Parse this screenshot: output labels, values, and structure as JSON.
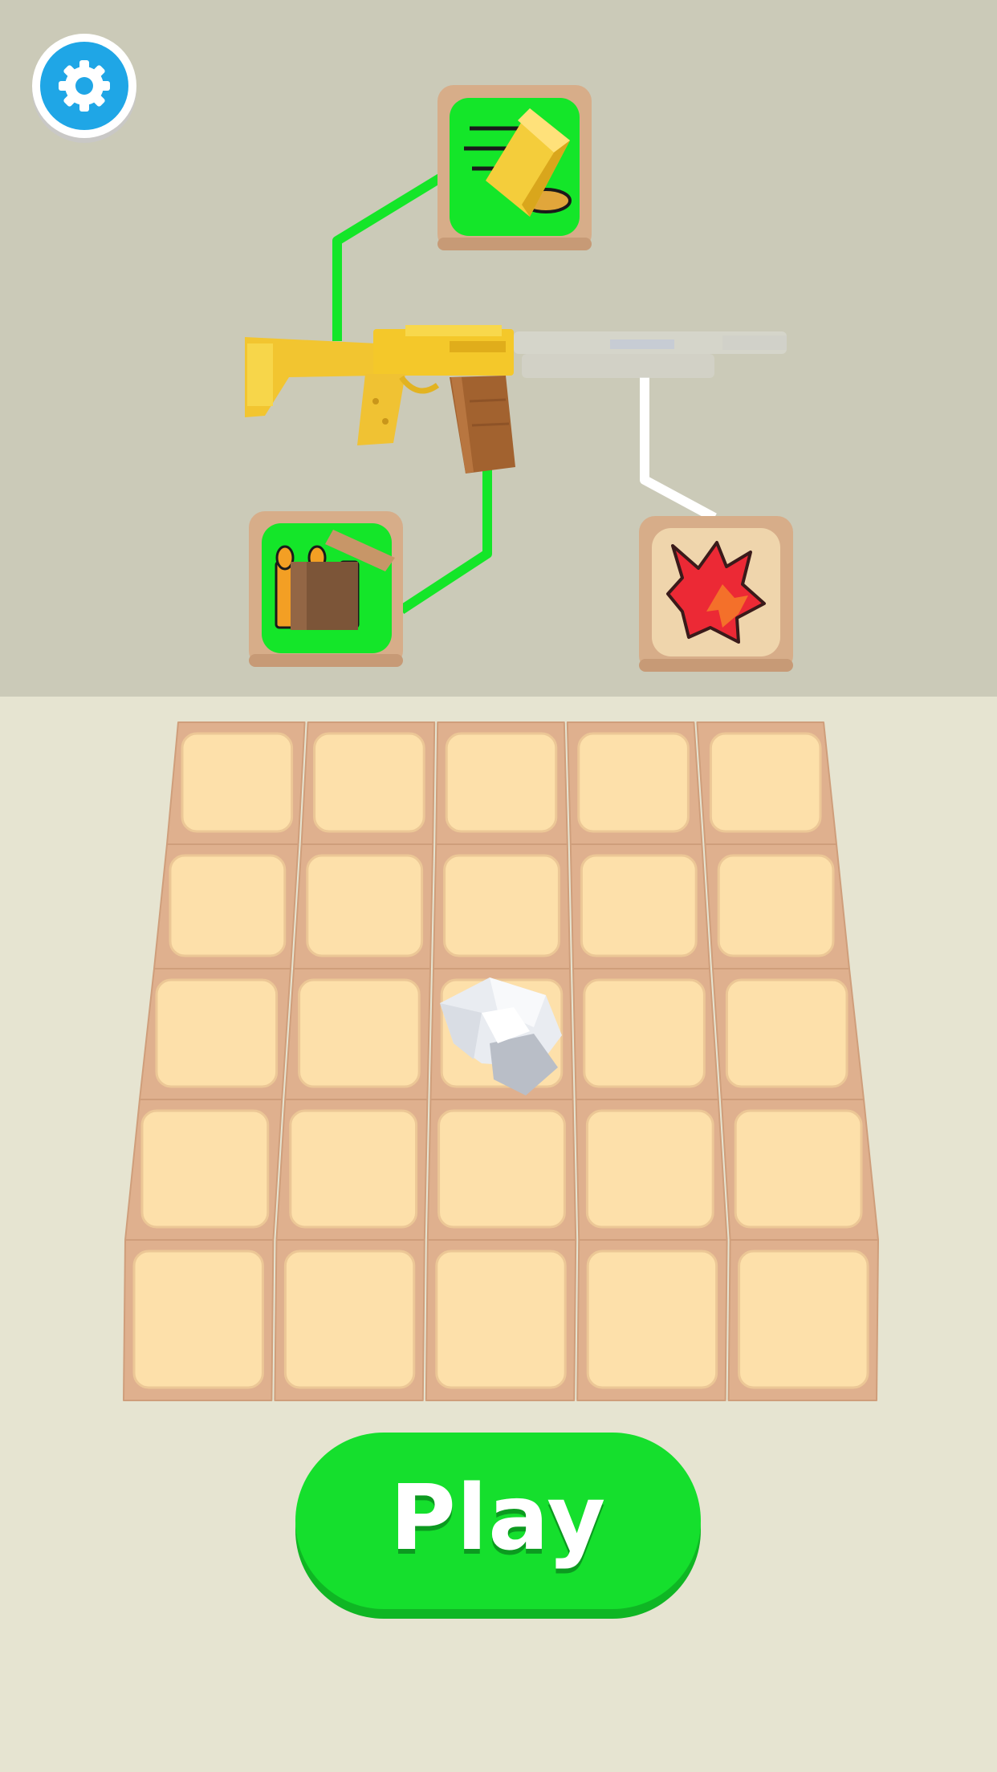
{
  "settings": {
    "icon": "gear-icon",
    "color": "#1fa6e6"
  },
  "weapon": {
    "name_icon": "assault-rifle",
    "upgrades": [
      {
        "id": "fire-rate",
        "icon": "gold-bar-bullet-icon",
        "unlocked": true
      },
      {
        "id": "ammo",
        "icon": "ammo-crate-icon",
        "unlocked": true
      },
      {
        "id": "damage",
        "icon": "explosion-icon",
        "unlocked": false
      }
    ]
  },
  "board": {
    "rows": 5,
    "columns": 5,
    "items": [
      {
        "row": 3,
        "column": 3,
        "icon": "diamond-rock-icon"
      }
    ]
  },
  "play_button": {
    "label": "Play",
    "color": "#15df2d"
  }
}
